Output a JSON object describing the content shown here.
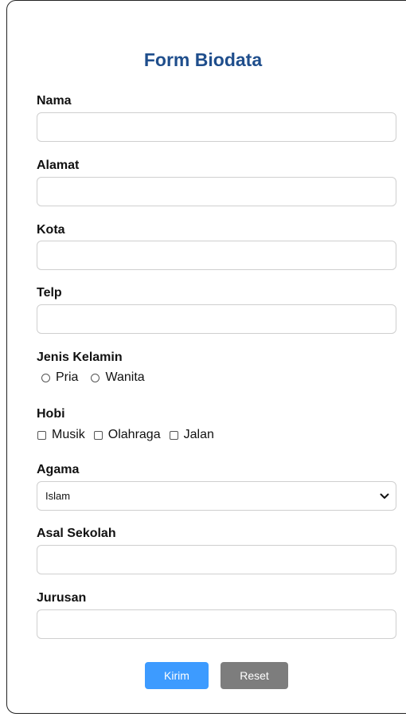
{
  "form": {
    "title": "Form Biodata",
    "fields": {
      "nama": {
        "label": "Nama",
        "value": ""
      },
      "alamat": {
        "label": "Alamat",
        "value": ""
      },
      "kota": {
        "label": "Kota",
        "value": ""
      },
      "telp": {
        "label": "Telp",
        "value": ""
      },
      "asal_sekolah": {
        "label": "Asal Sekolah",
        "value": ""
      },
      "jurusan": {
        "label": "Jurusan",
        "value": ""
      }
    },
    "gender": {
      "label": "Jenis Kelamin",
      "options": [
        "Pria",
        "Wanita"
      ],
      "selected": null
    },
    "hobby": {
      "label": "Hobi",
      "options": [
        "Musik",
        "Olahraga",
        "Jalan"
      ],
      "checked": []
    },
    "religion": {
      "label": "Agama",
      "selected": "Islam"
    },
    "buttons": {
      "submit": "Kirim",
      "reset": "Reset"
    }
  },
  "colors": {
    "title": "#1f4e8c",
    "submit_button": "#3d9bff",
    "reset_button": "#7d7d7d",
    "input_border": "#cfcfcf"
  },
  "icons": {
    "select_arrow": "chevron-down-icon"
  }
}
